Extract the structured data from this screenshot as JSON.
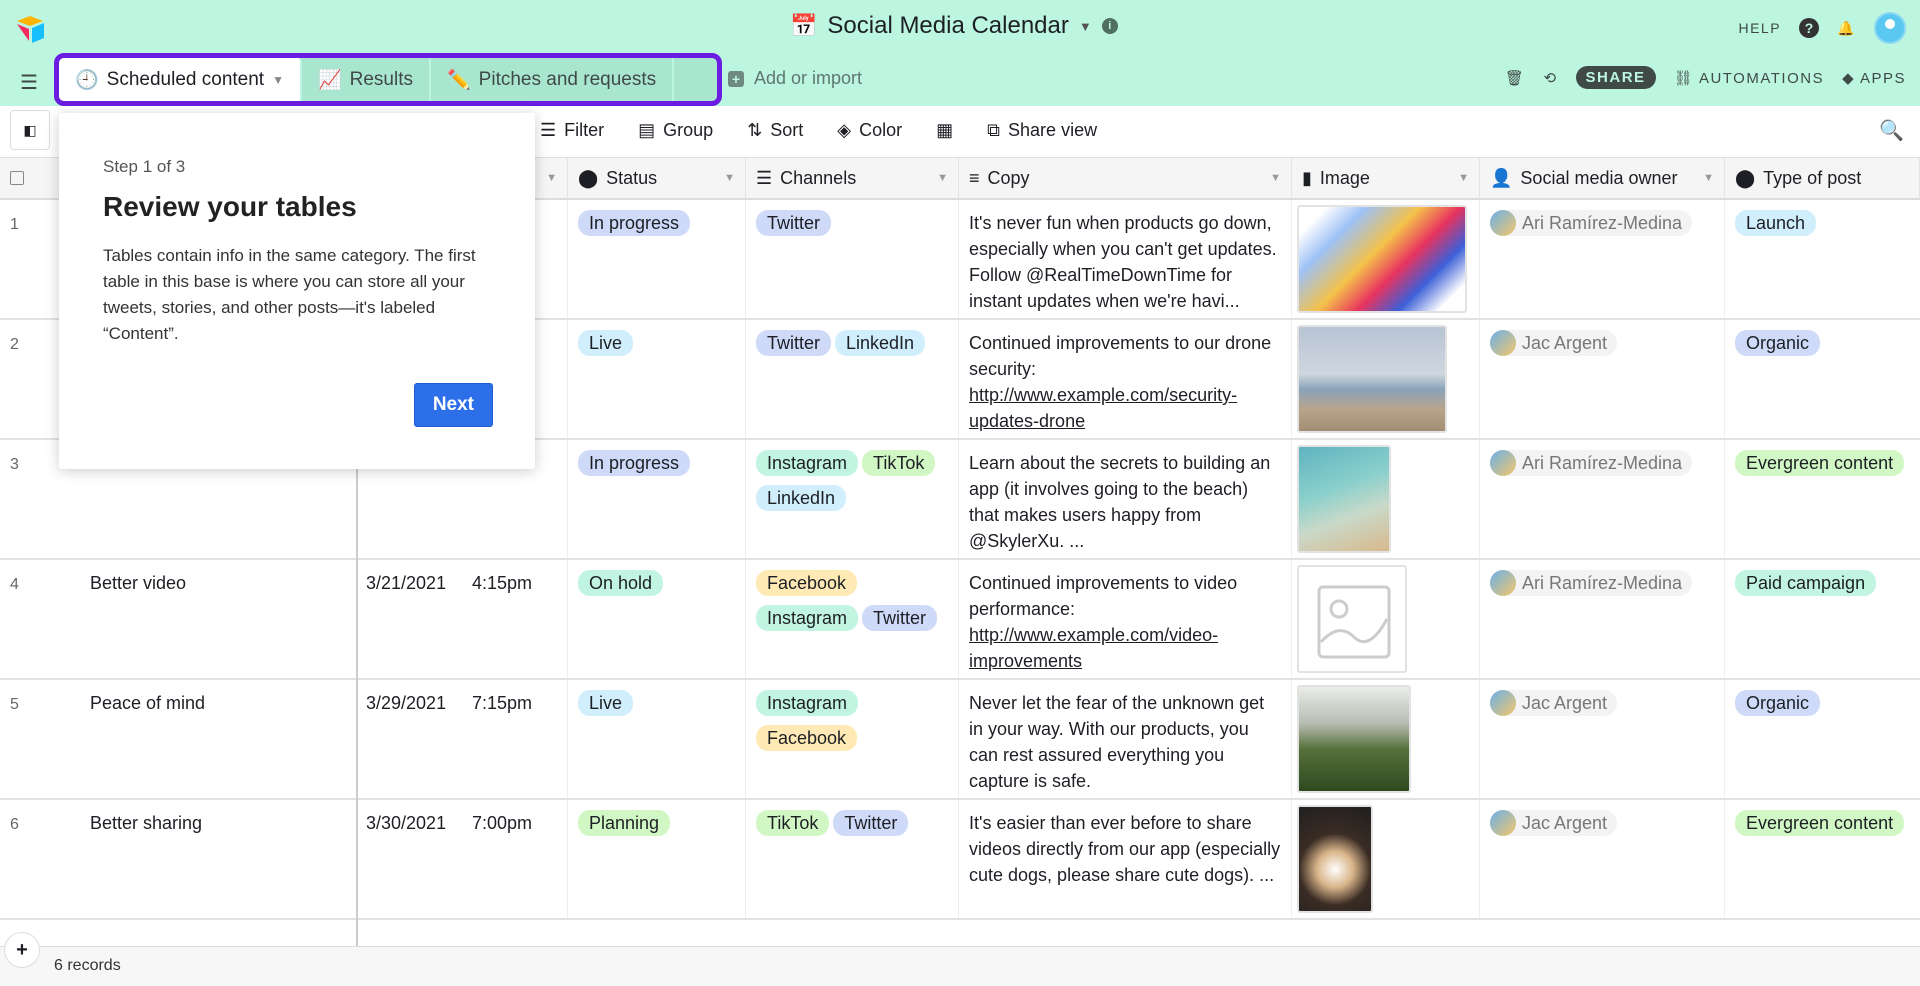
{
  "app": {
    "title": "Social Media Calendar",
    "help": "HELP"
  },
  "tabs": [
    {
      "label": "Scheduled content",
      "icon": "clock-icon",
      "active": true
    },
    {
      "label": "Results",
      "icon": "chart-icon"
    },
    {
      "label": "Pitches and requests",
      "icon": "pencil-icon"
    }
  ],
  "add_import": "Add or import",
  "actions": {
    "share": "SHARE",
    "automations": "AUTOMATIONS",
    "apps": "APPS"
  },
  "toolbar": {
    "filter": "Filter",
    "group": "Group",
    "sort": "Sort",
    "color": "Color",
    "share_view": "Share view"
  },
  "columns": {
    "status": "Status",
    "channels": "Channels",
    "copy": "Copy",
    "image": "Image",
    "owner": "Social media owner",
    "type": "Type of post"
  },
  "pill_colors": {
    "In progress": "#cfdaf8",
    "Live": "#d0eefb",
    "On hold": "#c2f5e1",
    "Planning": "#d1f7c4",
    "Twitter": "#cfdaf8",
    "LinkedIn": "#d0eefb",
    "Instagram": "#c2f5e1",
    "TikTok": "#d1f7c4",
    "Facebook": "#ffeab6",
    "Launch": "#d0eefb",
    "Organic": "#cfdaf8",
    "Evergreen content": "#d1f7c4",
    "Paid campaign": "#c2f5e1"
  },
  "rows": [
    {
      "num": "1",
      "name": "",
      "date": "",
      "time": "",
      "status": "In progress",
      "channels": [
        "Twitter"
      ],
      "copy": "It's never fun when products go down, especially when you can't get updates. Follow @RealTimeDownTime for instant updates when we're havi...",
      "link": "",
      "image": "illustration",
      "owner": "Ari Ramírez-Medina",
      "type": "Launch"
    },
    {
      "num": "2",
      "name": "",
      "date": "",
      "time": "",
      "status": "Live",
      "channels": [
        "Twitter",
        "LinkedIn"
      ],
      "copy": "Continued improvements to our drone security:",
      "link": "http://www.example.com/security-updates-drone",
      "image": "drone",
      "owner": "Jac Argent",
      "type": "Organic"
    },
    {
      "num": "3",
      "name": "",
      "date": "",
      "time": "",
      "status": "In progress",
      "channels": [
        "Instagram",
        "TikTok",
        "LinkedIn"
      ],
      "copy": "Learn about the secrets to building an app (it involves going to the beach) that makes users happy from @SkylerXu. ...",
      "link": "",
      "image": "beach",
      "owner": "Ari Ramírez-Medina",
      "type": "Evergreen content"
    },
    {
      "num": "4",
      "name": "Better video",
      "date": "3/21/2021",
      "time": "4:15pm",
      "status": "On hold",
      "channels": [
        "Facebook",
        "Instagram",
        "Twitter"
      ],
      "copy": "Continued improvements to video performance:",
      "link": "http://www.example.com/video-improvements",
      "image": "placeholder",
      "owner": "Ari Ramírez-Medina",
      "type": "Paid campaign"
    },
    {
      "num": "5",
      "name": "Peace of mind",
      "date": "3/29/2021",
      "time": "7:15pm",
      "status": "Live",
      "channels": [
        "Instagram",
        "Facebook"
      ],
      "copy": "Never let the fear of the unknown get in your way. With our products, you can rest assured everything you capture is safe.",
      "link": "",
      "image": "bicycle",
      "owner": "Jac Argent",
      "type": "Organic"
    },
    {
      "num": "6",
      "name": "Better sharing",
      "date": "3/30/2021",
      "time": "7:00pm",
      "status": "Planning",
      "channels": [
        "TikTok",
        "Twitter"
      ],
      "copy": "It's easier than ever before to share videos directly from our app (especially cute dogs, please share cute dogs). ...",
      "link": "",
      "image": "dog",
      "owner": "Jac Argent",
      "type": "Evergreen content"
    }
  ],
  "footer": {
    "records": "6 records"
  },
  "popover": {
    "step": "Step 1 of 3",
    "title": "Review your tables",
    "body": "Tables contain info in the same category. The first table in this base is where you can store all your tweets, stories, and other posts—it's labeled “Content”.",
    "next": "Next"
  },
  "accent": "#6a1de0",
  "topbar_color": "#bdf6e0"
}
